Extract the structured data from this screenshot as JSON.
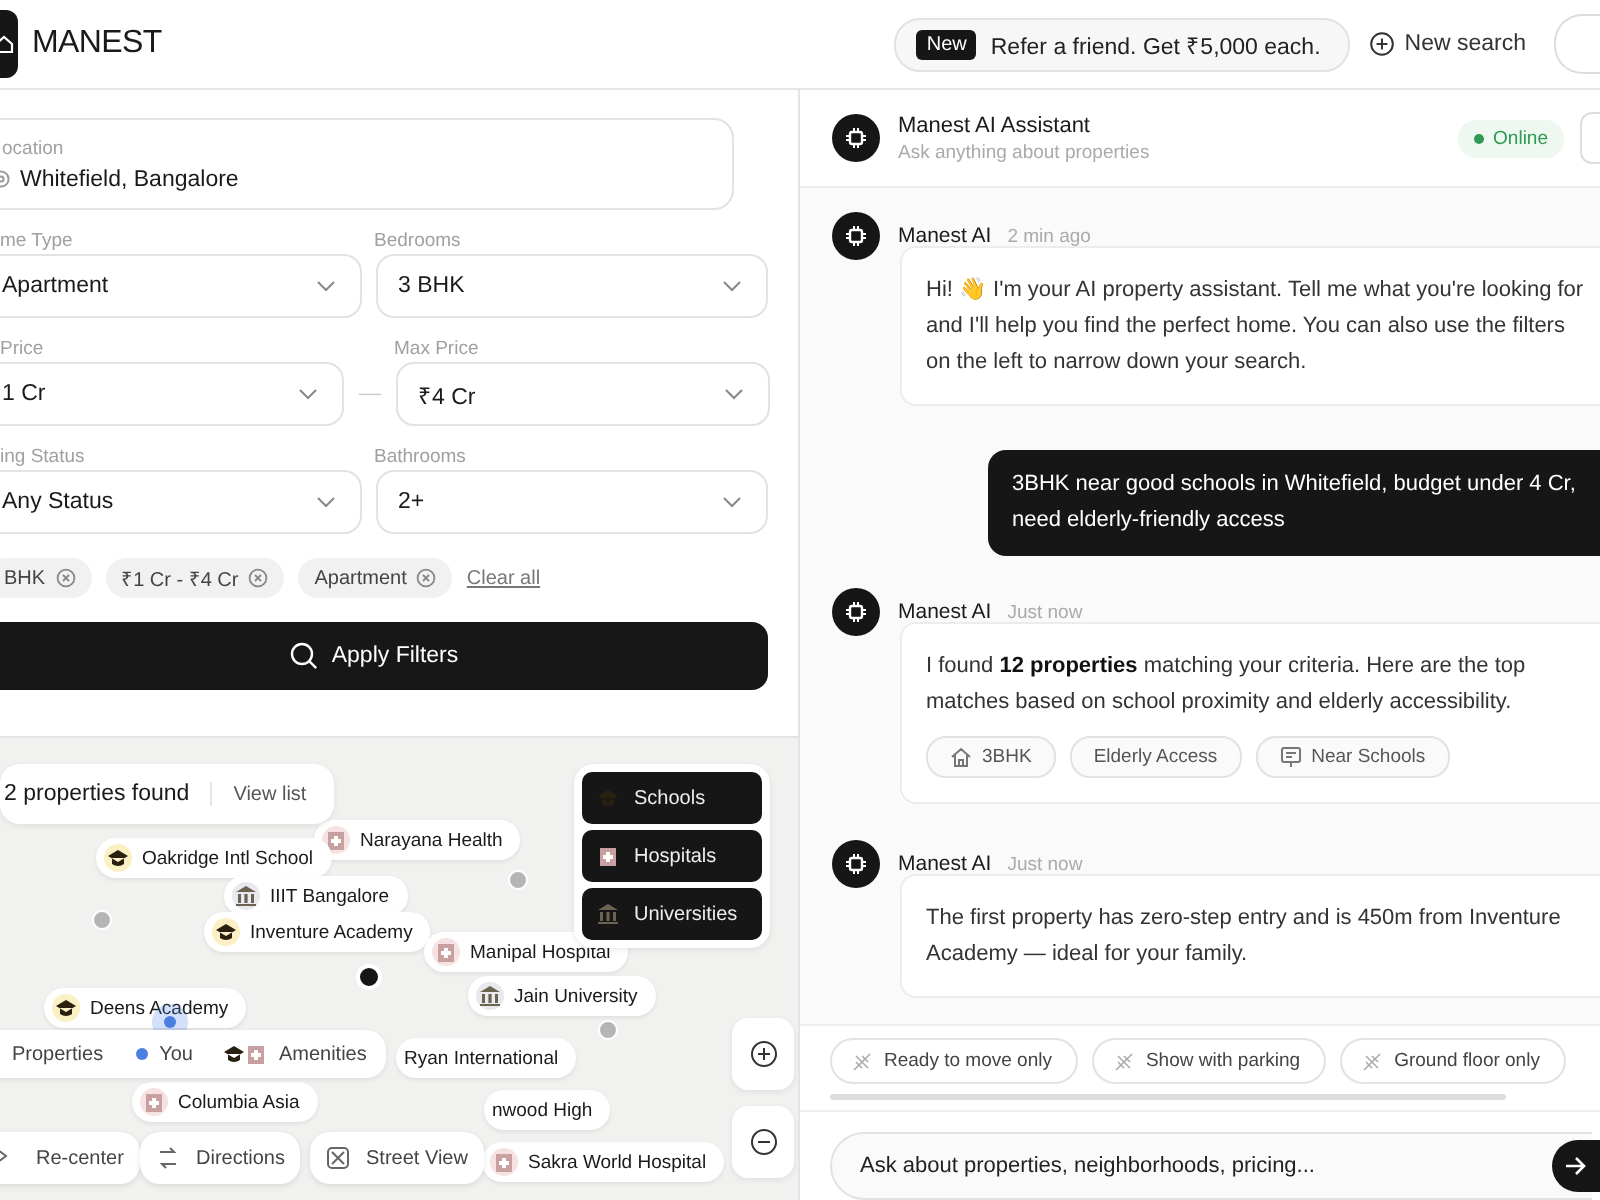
{
  "header": {
    "logo": "MANEST",
    "promo": {
      "badge": "New",
      "text": "Refer a friend. Get ₹5,000 each."
    },
    "new_search": "New search"
  },
  "filters": {
    "location": {
      "label": "ocation",
      "value": "Whitefield, Bangalore"
    },
    "selects": [
      {
        "label": "me Type",
        "value": "Apartment"
      },
      {
        "label": "Bedrooms",
        "value": "3 BHK"
      },
      {
        "label": "Price",
        "value": "1 Cr"
      },
      {
        "label": "Max Price",
        "value": "₹4 Cr"
      },
      {
        "label": "ing Status",
        "value": "Any Status"
      },
      {
        "label": "Bathrooms",
        "value": "2+"
      }
    ],
    "range_separator": "—",
    "chips": [
      "BHK",
      "₹1 Cr - ₹4 Cr",
      "Apartment"
    ],
    "clear_all": "Clear all",
    "apply": "Apply Filters"
  },
  "map": {
    "results": "2 properties found",
    "view_list": "View list",
    "layers": [
      {
        "label": "Schools",
        "kind": "school",
        "on": true
      },
      {
        "label": "Hospitals",
        "kind": "hospital",
        "on": true
      },
      {
        "label": "Universities",
        "kind": "university",
        "on": true
      }
    ],
    "pins": [
      {
        "label": "Narayana Health",
        "kind": "hospital"
      },
      {
        "label": "Oakridge Intl School",
        "kind": "school"
      },
      {
        "label": "IIIT Bangalore",
        "kind": "university"
      },
      {
        "label": "Inventure Academy",
        "kind": "school"
      },
      {
        "label": "Manipal Hospital",
        "kind": "hospital"
      },
      {
        "label": "Jain University",
        "kind": "university"
      },
      {
        "label": "Deens Academy",
        "kind": "school"
      },
      {
        "label": "Ryan International",
        "kind": "plain"
      },
      {
        "label": "Columbia Asia",
        "kind": "hospital"
      },
      {
        "label": "nwood High",
        "kind": "plain"
      },
      {
        "label": "Sakra World Hospital",
        "kind": "hospital"
      }
    ],
    "legend": [
      {
        "label": "Properties",
        "kind": "properties"
      },
      {
        "label": "You",
        "kind": "you"
      },
      {
        "label": "Amenities",
        "kind": "amenities"
      }
    ],
    "actions": [
      {
        "label": "Re-center",
        "kind": "recenter"
      },
      {
        "label": "Directions",
        "kind": "directions"
      },
      {
        "label": "Street View",
        "kind": "street"
      }
    ]
  },
  "chat": {
    "title": "Manest AI Assistant",
    "subtitle": "Ask anything about properties",
    "status": "Online",
    "messages": [
      {
        "kind": "ai",
        "name": "Manest AI",
        "time": "2 min ago",
        "text": "Hi! 👋 I'm your AI property assistant. Tell me what you're looking for and I'll help you find the perfect home. You can also use the filters on the left to narrow down your search."
      },
      {
        "kind": "user",
        "text": "3BHK near good schools in Whitefield, budget under 4 Cr, need elderly-friendly access"
      },
      {
        "kind": "ai",
        "name": "Manest AI",
        "time": "Just now",
        "text": "I found **12 properties** matching your criteria. Here are the top matches based on school proximity and elderly accessibility.",
        "tags": [
          {
            "label": "3BHK",
            "kind": "home"
          },
          {
            "label": "Elderly Access",
            "kind": "plain"
          },
          {
            "label": "Near Schools",
            "kind": "school"
          }
        ]
      },
      {
        "kind": "ai",
        "name": "Manest AI",
        "time": "Just now",
        "text": "The first property has zero-step entry and is 450m from Inventure Academy — ideal for your family."
      }
    ],
    "suggestions": [
      "Ready to move only",
      "Show with parking",
      "Ground floor only"
    ],
    "input_placeholder": "Ask about properties, neighborhoods, pricing..."
  }
}
